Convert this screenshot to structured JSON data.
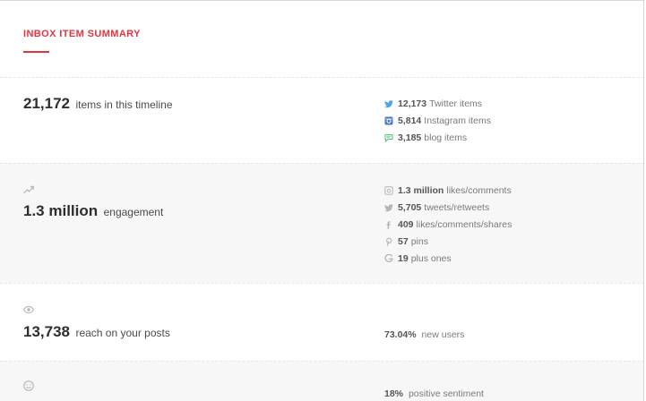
{
  "header": {
    "title": "INBOX ITEM SUMMARY"
  },
  "colors": {
    "accent": "#e0353f",
    "twitter": "#4aa7e3",
    "instagram": "#4a78c5",
    "blog": "#5fc27e",
    "muted_icon": "#b5b5b5"
  },
  "sections": {
    "items": {
      "value": "21,172",
      "label": "items in this timeline",
      "breakdown": [
        {
          "icon": "twitter-icon",
          "value": "12,173",
          "label": "Twitter items"
        },
        {
          "icon": "instagram-icon",
          "value": "5,814",
          "label": "Instagram items"
        },
        {
          "icon": "blog-icon",
          "value": "3,185",
          "label": "blog items"
        }
      ]
    },
    "engagement": {
      "icon": "trending-up-icon",
      "value": "1.3 million",
      "label": "engagement",
      "breakdown": [
        {
          "icon": "instagram-icon",
          "value": "1.3 million",
          "label": "likes/comments"
        },
        {
          "icon": "twitter-icon",
          "value": "5,705",
          "label": "tweets/retweets"
        },
        {
          "icon": "facebook-icon",
          "value": "409",
          "label": "likes/comments/shares"
        },
        {
          "icon": "pinterest-icon",
          "value": "57",
          "label": "pins"
        },
        {
          "icon": "google-icon",
          "value": "19",
          "label": "plus ones"
        }
      ]
    },
    "reach": {
      "icon": "eye-icon",
      "value": "13,738",
      "label": "reach on your posts",
      "detail": {
        "value": "73.04%",
        "label": "new users"
      }
    },
    "sentiment": {
      "icon": "smiley-icon",
      "detail": {
        "value": "18%",
        "label": "positive sentiment"
      }
    }
  }
}
